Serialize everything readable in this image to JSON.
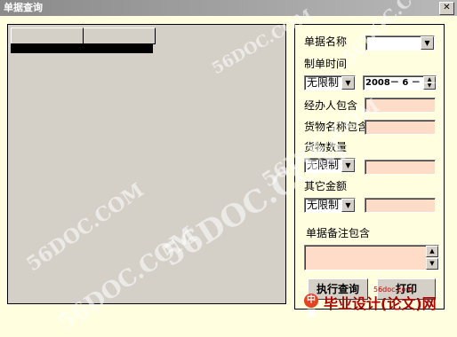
{
  "window": {
    "title": "单据查询",
    "close_glyph": "✕"
  },
  "filters": {
    "doc_name_label": "单据名称",
    "doc_name_value": "",
    "date_label": "制单时间",
    "date_mode": "无限制",
    "date_value": "2008－ 6 － 8",
    "handler_label": "经办人包含",
    "goods_name_label": "货物名称包含",
    "qty_label": "货物数量",
    "qty_mode": "无限制",
    "amount_label": "其它金额",
    "amount_mode": "无限制",
    "remark_label": "单据备注包含"
  },
  "buttons": {
    "run": "执行查询",
    "print": "打印"
  },
  "watermarks": [
    "56DOC.COM",
    "56DOC.COM",
    "56DOC.COM",
    "56DOC.COM",
    "56DOC.COM",
    "56DOC.COM"
  ],
  "footer": {
    "brand": "毕业设计(论文)网",
    "domain": "56doc.com",
    "prefix": "中国"
  }
}
